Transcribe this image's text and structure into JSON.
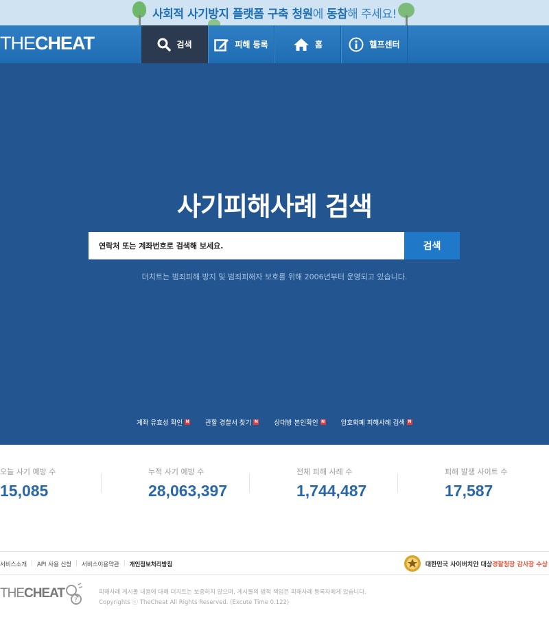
{
  "banner": {
    "text_bold": "사회적 사기방지 플랫폼 구축 청원",
    "text_mid": "에 ",
    "text_bold2": "동참",
    "text_end": "해 주세요!"
  },
  "nav": {
    "logo_light": "THE",
    "logo_bold": "CHEAT",
    "items": [
      {
        "label": "검색",
        "icon": "search-icon"
      },
      {
        "label": "피해 등록",
        "icon": "edit-icon"
      },
      {
        "label": "홈",
        "icon": "home-icon"
      },
      {
        "label": "헬프센터",
        "icon": "info-icon"
      }
    ]
  },
  "hero": {
    "title": "사기피해사례 검색",
    "search_placeholder": "연락처 또는 계좌번호로 검색해 보세요.",
    "search_button": "검색",
    "description": "더치트는 범죄피해 방지 및 범죄피해자 보호를 위해 2006년부터 운영되고 있습니다.",
    "quick_links": [
      {
        "label": "계좌 유효성 확인",
        "badge": "N"
      },
      {
        "label": "관할 경찰서 찾기",
        "badge": "N"
      },
      {
        "label": "상대방 본인확인",
        "badge": "N"
      },
      {
        "label": "암호화폐 피해사례 검색",
        "badge": "N"
      }
    ]
  },
  "stats": [
    {
      "label": "오늘 사기 예방 수",
      "value": "15,085"
    },
    {
      "label": "누적 사기 예방 수",
      "value": "28,063,397"
    },
    {
      "label": "전체 피해 사례 수",
      "value": "1,744,487"
    },
    {
      "label": "피해 발생 사이트 수",
      "value": "17,587"
    }
  ],
  "footer": {
    "links": [
      "서비스소개",
      "API 사용 신청",
      "서비스이용약관",
      "개인정보처리방침"
    ],
    "award_prefix": "대한민국 사이버치안 대상 ",
    "award_highlight": "경찰청장 감사장 수상",
    "logo_light": "THE",
    "logo_bold": "CHEAT",
    "notice": "피해사례 게시물 내용에 대해 더치트는 보증하지 않으며, 게시물의 법적 책임은 피해사례 등록자에게 있습니다.",
    "copyright": "Copyrights ⓒ TheCheat All Rights Reserved. (Excute Time 0.122)"
  }
}
